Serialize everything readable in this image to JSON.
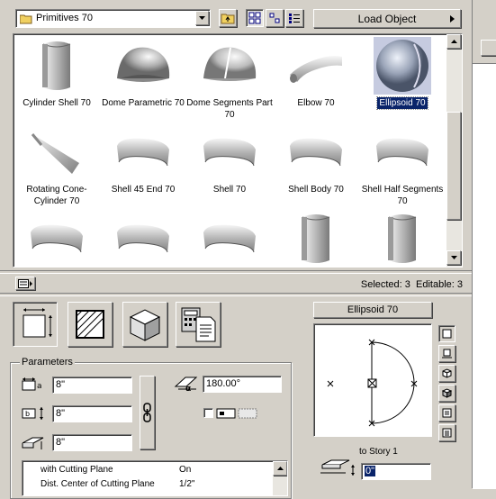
{
  "toolbar": {
    "library_name": "Primitives 70",
    "load_object_label": "Load Object"
  },
  "library_items": [
    {
      "label": "Cylinder Shell 70",
      "icon": "cylinder-shell"
    },
    {
      "label": "Dome Parametric 70",
      "icon": "dome"
    },
    {
      "label": "Dome Segments Part 70",
      "icon": "dome-segment"
    },
    {
      "label": "Elbow 70",
      "icon": "elbow"
    },
    {
      "label": "Ellipsoid 70",
      "icon": "ellipsoid",
      "selected": true
    },
    {
      "label": "Rotating Cone-Cylinder 70",
      "icon": "cone"
    },
    {
      "label": "Shell 45 End 70",
      "icon": "shell"
    },
    {
      "label": "Shell 70",
      "icon": "shell"
    },
    {
      "label": "Shell Body 70",
      "icon": "shell"
    },
    {
      "label": "Shell Half Segments 70",
      "icon": "shell"
    }
  ],
  "status": {
    "selected_editable": "Selected: 3  Editable: 3"
  },
  "preview": {
    "title": "Ellipsoid 70",
    "story_label": "to Story 1",
    "story_value": "0\""
  },
  "parameters": {
    "title": "Parameters",
    "width": "8\"",
    "depth": "8\"",
    "height": "8\"",
    "angle": "180.00°",
    "rows": [
      {
        "name": "with Cutting Plane",
        "value": "On"
      },
      {
        "name": "Dist. Center of Cutting Plane",
        "value": "1/2\""
      }
    ]
  },
  "colors": {
    "selection": "#0a246a",
    "face": "#d4d0c8"
  }
}
